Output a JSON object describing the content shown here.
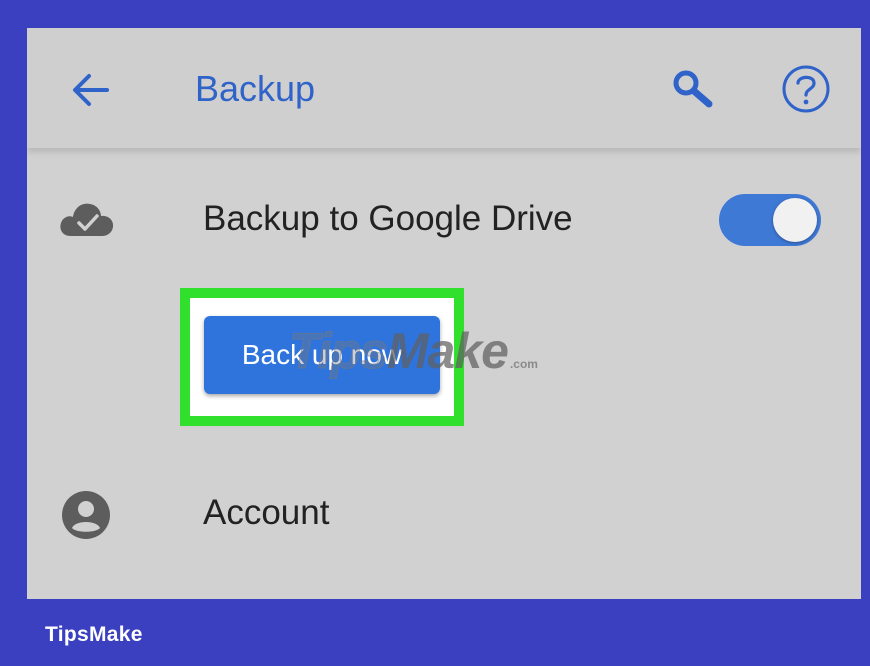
{
  "toolbar": {
    "title": "Backup",
    "back_icon": "arrow-left-icon",
    "search_icon": "search-icon",
    "help_icon": "help-circle-icon"
  },
  "drive_row": {
    "icon": "cloud-check-icon",
    "label": "Backup to Google Drive",
    "toggle_on": true
  },
  "backup_now": {
    "label": "Back up now"
  },
  "account_row": {
    "icon": "account-circle-icon",
    "label": "Account"
  },
  "watermark": {
    "tips": "Tips",
    "make": "Make",
    "com": ".com"
  },
  "brand": {
    "name": "TipsMake"
  },
  "colors": {
    "accent": "#2f63c9",
    "button": "#2f74dc",
    "toggle": "#3f79d6",
    "highlight": "#31e02c",
    "frame_border": "#3b40c0",
    "background": "#d1d1d1"
  }
}
